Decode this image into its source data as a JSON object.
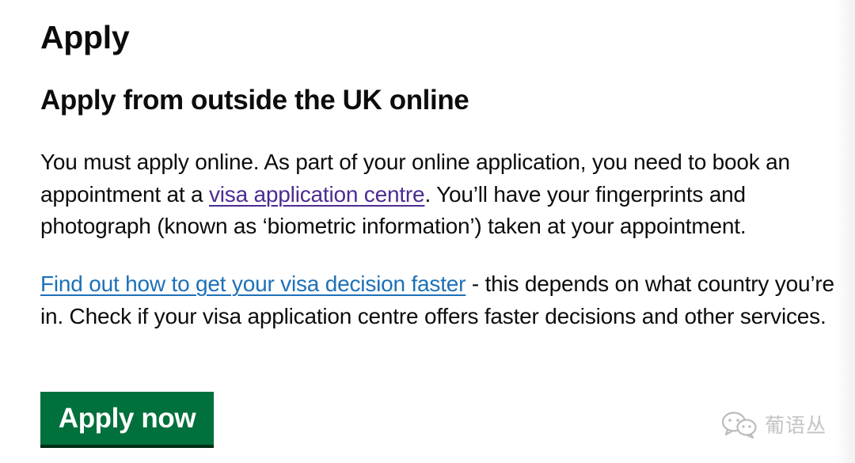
{
  "page": {
    "title": "Apply",
    "section_heading": "Apply from outside the UK online"
  },
  "paragraph1": {
    "before_link": "You must apply online. As part of your online application, you need to book an appointment at a ",
    "link_text": "visa application centre",
    "after_link": ". You’ll have your fingerprints and photograph (known as ‘biometric information’) taken at your appointment."
  },
  "paragraph2": {
    "link_text": "Find out how to get your visa decision faster",
    "after_link": " - this depends on what country you’re in. Check if your visa application centre offers faster decisions and other services."
  },
  "button": {
    "label": "Apply now"
  },
  "watermark": {
    "icon": "wechat-icon",
    "text": "葡语丛"
  },
  "colors": {
    "text": "#0b0c0c",
    "visited_link": "#4c2c92",
    "link": "#1d70b8",
    "button_bg": "#00703c",
    "button_text": "#ffffff"
  }
}
